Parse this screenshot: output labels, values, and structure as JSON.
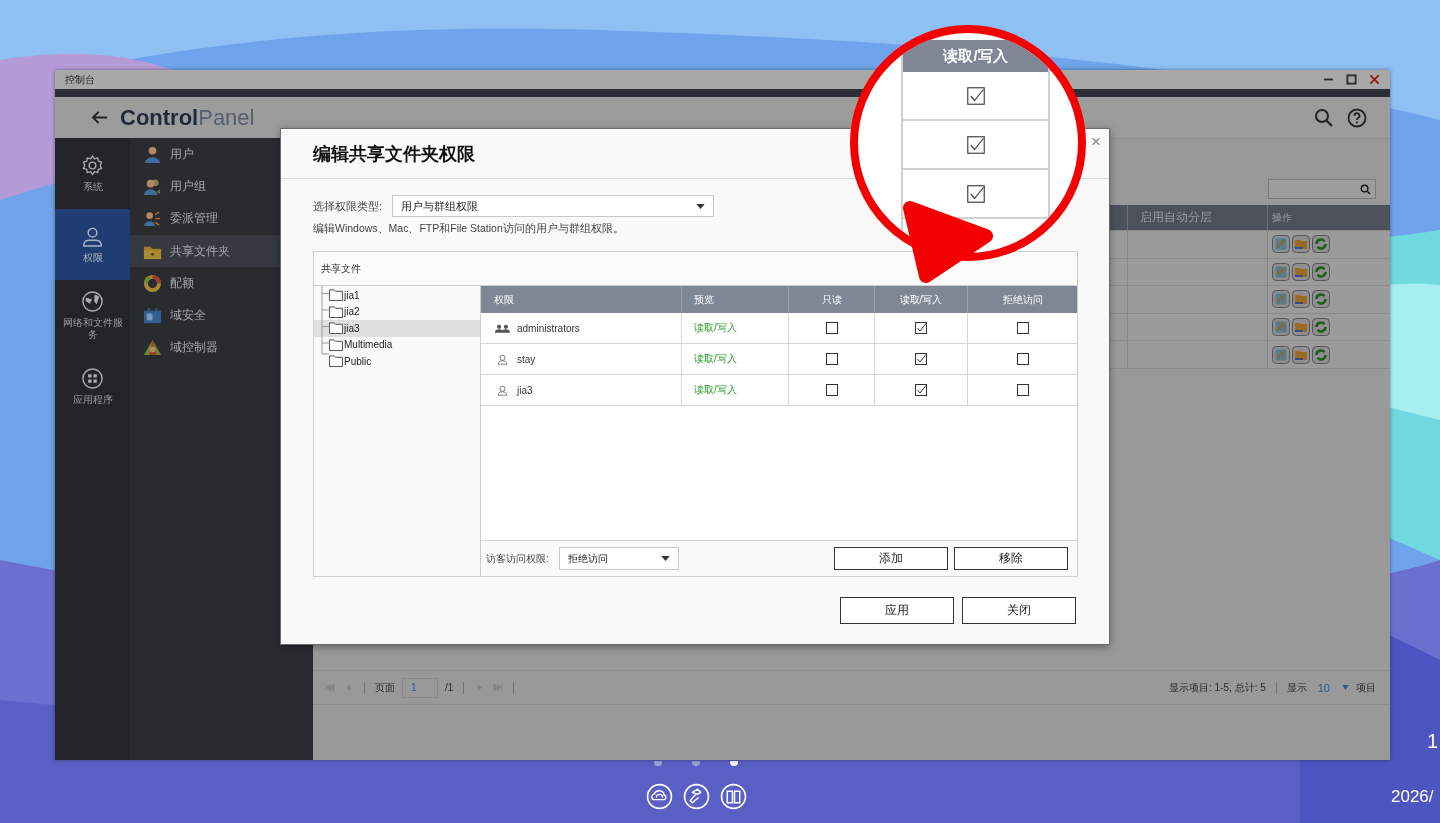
{
  "window": {
    "title": "控制台"
  },
  "header": {
    "title_bold": "Control",
    "title_light": "Panel"
  },
  "nav": [
    {
      "label": "系统",
      "kind": "gear",
      "selected": false
    },
    {
      "label": "权限",
      "kind": "user",
      "selected": true
    },
    {
      "label": "网络和文件服务",
      "kind": "globe",
      "selected": false
    },
    {
      "label": "应用程序",
      "kind": "apps",
      "selected": false
    }
  ],
  "submenu": [
    {
      "label": "用户",
      "kind": "user",
      "selected": false
    },
    {
      "label": "用户组",
      "kind": "group",
      "selected": false
    },
    {
      "label": "委派管理",
      "kind": "delegate",
      "selected": false
    },
    {
      "label": "共享文件夹",
      "kind": "folder",
      "selected": true
    },
    {
      "label": "配额",
      "kind": "quota",
      "selected": false
    },
    {
      "label": "域安全",
      "kind": "security",
      "selected": false
    },
    {
      "label": "域控制器",
      "kind": "controller",
      "selected": false
    }
  ],
  "main_table": {
    "columns": [
      "启用自动分层",
      "操作"
    ],
    "rows": [
      {
        "actions": [
          {
            "kind": "edit"
          },
          {
            "kind": "permission"
          },
          {
            "kind": "refresh"
          }
        ]
      },
      {
        "actions": [
          {
            "kind": "edit"
          },
          {
            "kind": "permission"
          },
          {
            "kind": "refresh"
          }
        ]
      },
      {
        "actions": [
          {
            "kind": "edit"
          },
          {
            "kind": "permission"
          },
          {
            "kind": "refresh"
          }
        ]
      },
      {
        "actions": [
          {
            "kind": "edit"
          },
          {
            "kind": "permission"
          },
          {
            "kind": "refresh"
          }
        ]
      },
      {
        "actions": [
          {
            "kind": "edit"
          },
          {
            "kind": "permission"
          },
          {
            "kind": "refresh"
          }
        ]
      }
    ]
  },
  "pagination": {
    "page_label": "页面",
    "page": "1",
    "total": "/1",
    "summary": "显示项目: 1-5, 总计: 5",
    "show_label": "显示",
    "page_size": "10",
    "items_label": "项目"
  },
  "dialog": {
    "title": "编辑共享文件夹权限",
    "close": "×",
    "type_label": "选择权限类型:",
    "type_value": "用户与群组权限",
    "description": "编辑Windows、Mac、FTP和File Station访问的用户与群组权限。",
    "panel_title": "共享文件",
    "folders": [
      {
        "name": "jia1",
        "selected": false
      },
      {
        "name": "jia2",
        "selected": false
      },
      {
        "name": "jia3",
        "selected": true
      },
      {
        "name": "Multimedia",
        "selected": false
      },
      {
        "name": "Public",
        "selected": false
      }
    ],
    "columns": [
      "权限",
      "预览",
      "只读",
      "读取/写入",
      "拒绝访问"
    ],
    "rows": [
      {
        "name": "administrators",
        "kind": "group",
        "preview": "读取/写入",
        "read_only": false,
        "read_write": true,
        "deny": false
      },
      {
        "name": "stay",
        "kind": "user",
        "preview": "读取/写入",
        "read_only": false,
        "read_write": true,
        "deny": false
      },
      {
        "name": "jia3",
        "kind": "user",
        "preview": "读取/写入",
        "read_only": false,
        "read_write": true,
        "deny": false
      }
    ],
    "guest_label": "访客访问权限:",
    "guest_value": "拒绝访问",
    "list_buttons": [
      "添加",
      "移除"
    ],
    "buttons": [
      "应用",
      "关闭"
    ]
  },
  "magnifier": {
    "header": "读取/写入",
    "checks": [
      true,
      true,
      true
    ]
  },
  "page_dots": [
    {
      "selected": false
    },
    {
      "selected": false
    },
    {
      "selected": true
    }
  ],
  "dock": [
    {
      "kind": "cloud"
    },
    {
      "kind": "hammer"
    },
    {
      "kind": "book"
    }
  ],
  "clock": {
    "time": "1",
    "date": "2026/"
  }
}
